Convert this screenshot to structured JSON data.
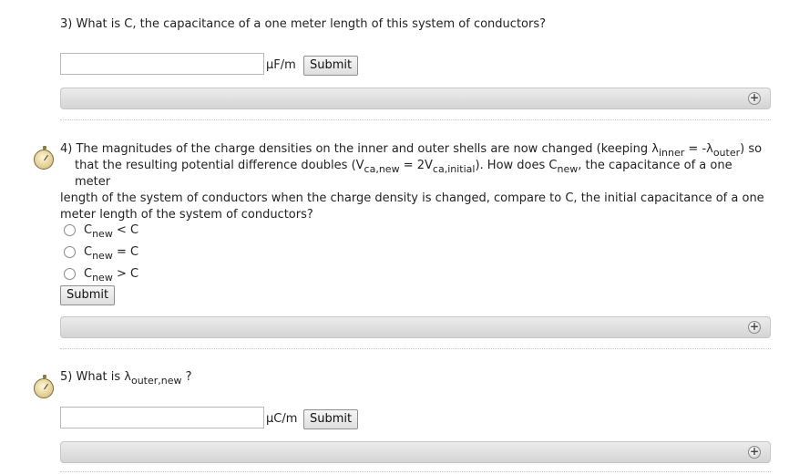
{
  "q3": {
    "text": "3) What is C, the capacitance of a one meter length of this system of conductors?",
    "unit": "μF/m",
    "submit": "Submit"
  },
  "q4": {
    "line1_a": "4) The magnitudes of the charge densities on the inner and outer shells are now changed (keeping λ",
    "line1_sub1": "inner",
    "line1_b": " = -λ",
    "line1_sub2": "outer",
    "line1_c": ") so",
    "line2_a": "that the resulting potential difference doubles (V",
    "line2_sub1": "ca,new",
    "line2_b": " = 2V",
    "line2_sub2": "ca,initial",
    "line2_c": "). How does C",
    "line2_sub3": "new",
    "line2_d": ", the capacitance of a one meter",
    "line3": "length of the system of conductors when the charge density is changed, compare to C, the initial capacitance of a one",
    "line4": "meter length of the system of conductors?",
    "options": [
      {
        "pre": "C",
        "sub": "new",
        "post": " < C"
      },
      {
        "pre": "C",
        "sub": "new",
        "post": " = C"
      },
      {
        "pre": "C",
        "sub": "new",
        "post": " > C"
      }
    ],
    "submit": "Submit"
  },
  "q5": {
    "text_a": "5) What is λ",
    "sub": "outer,new",
    "text_b": " ?",
    "unit": "μC/m",
    "submit": "Submit"
  },
  "icons": {
    "expand": "plus-circle-icon",
    "timer": "stopwatch-icon"
  }
}
